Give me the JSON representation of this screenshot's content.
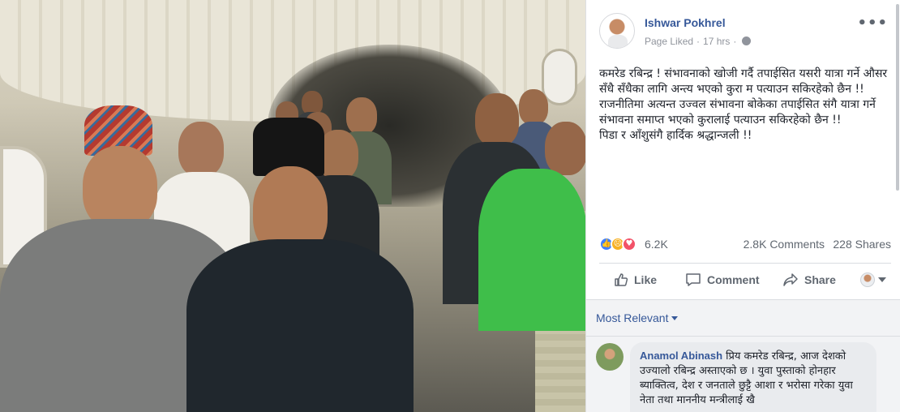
{
  "post": {
    "author": "Ishwar Pokhrel",
    "status": "Page Liked",
    "time": "17 hrs",
    "text": "कमरेड रबिन्द्र ! संभावनाको खोजी गर्दै तपाईसित यसरी यात्रा गर्ने औसर सँधै सँधैका लागि अन्त्य भएको कुरा म पत्याउन सकिरहेको छैन !! राजनीतिमा अत्यन्त उज्वल संभावना बोकेका तपाईसित संगै यात्रा गर्ने संभावना समाप्त भएको कुरालाई पत्याउन सकिरहेको छैन !!\nपिडा र आँशुसंगै हार्दिक श्रद्धान्जली !!"
  },
  "stats": {
    "reactions": "6.2K",
    "comments": "2.8K Comments",
    "shares": "228 Shares"
  },
  "actions": {
    "like": "Like",
    "comment": "Comment",
    "share": "Share"
  },
  "comments": {
    "sort_label": "Most Relevant",
    "items": [
      {
        "author": "Anamol Abinash",
        "text": "प्रिय कमरेड रबिन्द्र, आज देशको उज्यालो रबिन्द्र अस्ताएको छ । युवा पुस्ताको होनहार ब्याक्तित्व, देश र जनताले छुट्टै आशा र भरोसा गरेका युवा नेता तथा माननीय मन्त्रीलाई खै"
      }
    ]
  },
  "icons": {
    "more": "more-options-icon",
    "privacy": "globe-icon",
    "reaction_types": [
      "like",
      "sad",
      "love"
    ]
  },
  "colors": {
    "link": "#365899",
    "like": "#4080ff",
    "sad": "#f7b125",
    "love": "#f25268"
  }
}
